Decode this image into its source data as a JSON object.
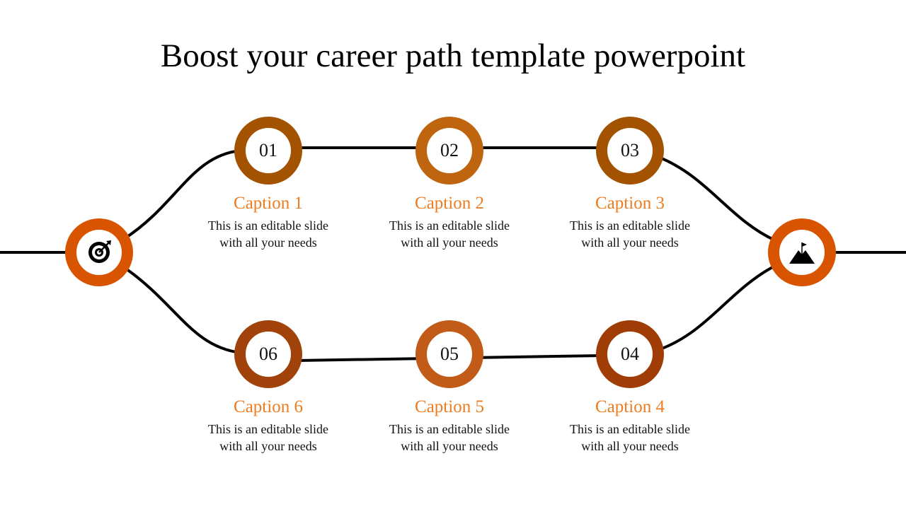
{
  "title": "Boost your career path template powerpoint",
  "start_icon": "target-icon",
  "end_icon": "mountain-flag-icon",
  "colors": {
    "start": "#d95400",
    "end": "#d95400",
    "line": "#000000",
    "caption": "#ed7d22"
  },
  "steps": [
    {
      "num": "01",
      "caption": "Caption 1",
      "line1": "This is an editable slide",
      "line2": "with all your needs",
      "color": "#a35200"
    },
    {
      "num": "02",
      "caption": "Caption 2",
      "line1": "This is an editable slide",
      "line2": "with all your needs",
      "color": "#c0650f"
    },
    {
      "num": "03",
      "caption": "Caption 3",
      "line1": "This is an editable slide",
      "line2": "with all your needs",
      "color": "#a35200"
    },
    {
      "num": "04",
      "caption": "Caption 4",
      "line1": "This is an editable slide",
      "line2": "with all your needs",
      "color": "#a03c05"
    },
    {
      "num": "05",
      "caption": "Caption 5",
      "line1": "This is an editable slide",
      "line2": "with all your needs",
      "color": "#c25a18"
    },
    {
      "num": "06",
      "caption": "Caption 6",
      "line1": "This is an editable slide",
      "line2": "with all your needs",
      "color": "#a0420a"
    }
  ]
}
